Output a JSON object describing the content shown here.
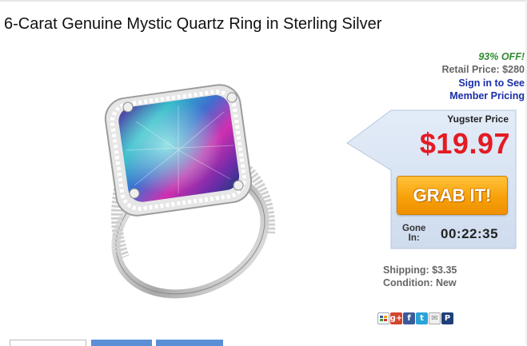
{
  "product": {
    "title": "6-Carat Genuine Mystic Quartz Ring in Sterling Silver"
  },
  "pricing": {
    "discount": "93% OFF!",
    "retail_price": "Retail Price: $280",
    "signin_line1": "Sign in to See",
    "signin_line2": "Member Pricing",
    "yugster_label": "Yugster Price",
    "price": "$19.97",
    "grab_label": "GRAB IT!",
    "gone_line1": "Gone",
    "gone_line2": "In:",
    "countdown": "00:22:35",
    "shipping": "Shipping: $3.35",
    "condition": "Condition: New"
  },
  "share": {
    "icons": [
      "share-icon",
      "google-plus-icon",
      "facebook-icon",
      "twitter-icon",
      "email-icon",
      "pinterest-icon"
    ]
  },
  "colors": {
    "price_red": "#e31b23",
    "discount_green": "#2e8b2e",
    "link_blue": "#1a2ea8",
    "button_orange": "#f7a10a",
    "panel_blue": "#d6e3f3"
  }
}
